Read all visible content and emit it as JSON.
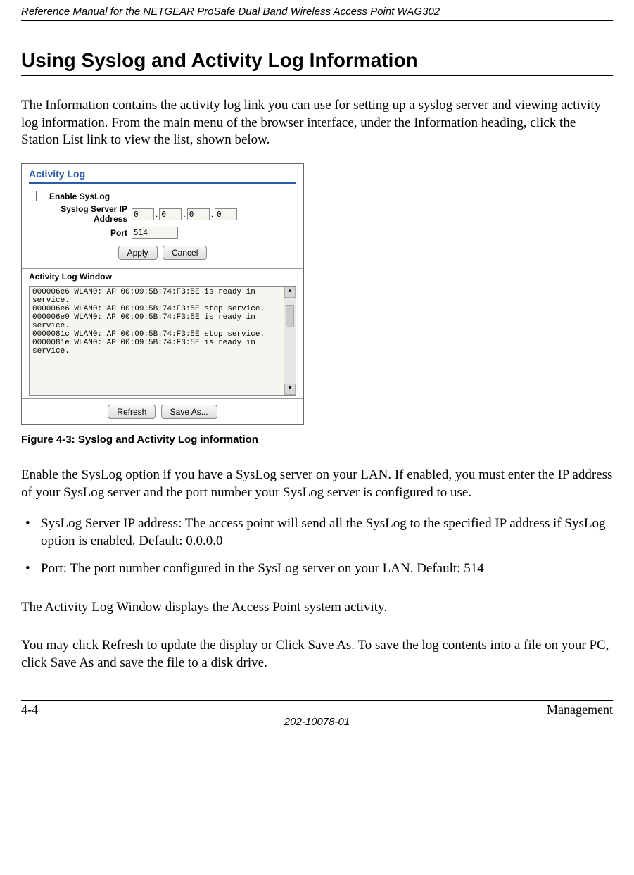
{
  "header": {
    "title": "Reference Manual for the NETGEAR ProSafe Dual Band Wireless Access Point WAG302"
  },
  "section": {
    "heading": "Using Syslog and Activity Log Information",
    "intro": "The Information contains the activity log link you can use for setting up a syslog server and viewing activity log information. From the main menu of the browser interface, under the Information heading, click the Station List link to view the list, shown below."
  },
  "screenshot": {
    "panel_title": "Activity Log",
    "enable_label": "Enable SysLog",
    "ip_label": "Syslog Server IP Address",
    "port_label": "Port",
    "ip": {
      "a": "0",
      "b": "0",
      "c": "0",
      "d": "0"
    },
    "port_value": "514",
    "apply": "Apply",
    "cancel": "Cancel",
    "window_label": "Activity Log Window",
    "log_text": "000006e6 WLAN0: AP 00:09:5B:74:F3:5E is ready in service.\n000006e6 WLAN0: AP 00:09:5B:74:F3:5E stop service.\n000006e9 WLAN0: AP 00:09:5B:74:F3:5E is ready in service.\n0000081c WLAN0: AP 00:09:5B:74:F3:5E stop service.\n0000081e WLAN0: AP 00:09:5B:74:F3:5E is ready in service.",
    "refresh": "Refresh",
    "save_as": "Save As..."
  },
  "figure": {
    "caption": "Figure 4-3:  Syslog and Activity Log information"
  },
  "paragraphs": {
    "p1": "Enable the SysLog option if you have a SysLog server on your LAN. If enabled, you must enter the IP address of your SysLog server and the port number your SysLog server is configured to use.",
    "b1": "SysLog Server IP address: The access point will send all the SysLog to the specified IP address if SysLog option is enabled. Default: 0.0.0.0",
    "b2": "Port: The port number configured in the SysLog server on your LAN. Default: 514",
    "p2": "The Activity Log Window displays the Access Point system activity.",
    "p3": "You may click Refresh to update the display or Click Save As. To save the log contents into a file on your PC, click Save As and save the file to a disk drive."
  },
  "footer": {
    "left": "4-4",
    "right": "Management",
    "center": "202-10078-01"
  }
}
